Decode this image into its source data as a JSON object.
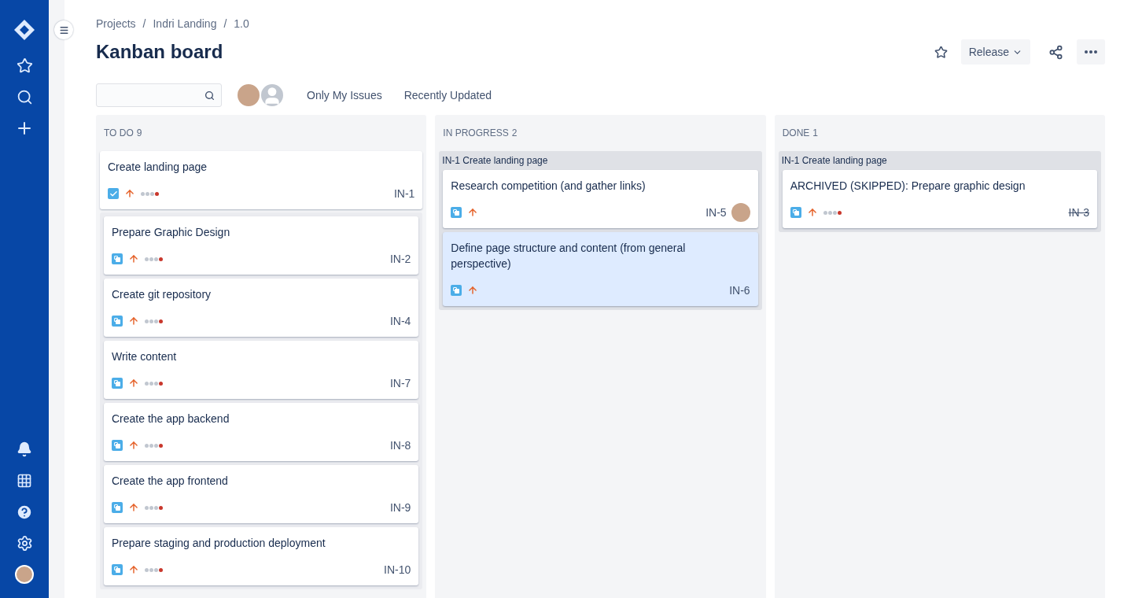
{
  "breadcrumbs": {
    "separator": "/",
    "items": [
      "Projects",
      "Indri Landing",
      "1.0"
    ]
  },
  "title": "Kanban board",
  "actions": {
    "release": "Release"
  },
  "filters": {
    "quick_filters": [
      "Only My Issues",
      "Recently Updated"
    ]
  },
  "columns": [
    {
      "title": "TO DO",
      "count": "9",
      "parent": {
        "title": "Create landing page",
        "kind": "task",
        "key": "IN-1",
        "done": false,
        "estimate": true,
        "assigned": false,
        "selected": false
      },
      "cards": [
        {
          "title": "Prepare Graphic Design",
          "kind": "subtask",
          "key": "IN-2",
          "done": false,
          "estimate": true,
          "assigned": false,
          "selected": false
        },
        {
          "title": "Create git repository",
          "kind": "subtask",
          "key": "IN-4",
          "done": false,
          "estimate": true,
          "assigned": false,
          "selected": false
        },
        {
          "title": "Write content",
          "kind": "subtask",
          "key": "IN-7",
          "done": false,
          "estimate": true,
          "assigned": false,
          "selected": false
        },
        {
          "title": "Create the app backend",
          "kind": "subtask",
          "key": "IN-8",
          "done": false,
          "estimate": true,
          "assigned": false,
          "selected": false
        },
        {
          "title": "Create the app frontend",
          "kind": "subtask",
          "key": "IN-9",
          "done": false,
          "estimate": true,
          "assigned": false,
          "selected": false
        },
        {
          "title": "Prepare staging and production deployment",
          "kind": "subtask",
          "key": "IN-10",
          "done": false,
          "estimate": true,
          "assigned": false,
          "selected": false
        }
      ]
    },
    {
      "title": "IN PROGRESS",
      "count": "2",
      "group_label": "IN-1 Create landing page",
      "cards": [
        {
          "title": "Research competition (and gather links)",
          "kind": "subtask",
          "key": "IN-5",
          "done": false,
          "estimate": false,
          "assigned": true,
          "selected": false
        },
        {
          "title": "Define page structure and content (from general perspective)",
          "kind": "subtask",
          "key": "IN-6",
          "done": false,
          "estimate": false,
          "assigned": false,
          "selected": true
        }
      ]
    },
    {
      "title": "DONE",
      "count": "1",
      "group_label": "IN-1 Create landing page",
      "cards": [
        {
          "title": "ARCHIVED (SKIPPED): Prepare graphic design",
          "kind": "subtask",
          "key": "IN-3",
          "done": true,
          "estimate": true,
          "assigned": false,
          "selected": false
        }
      ]
    }
  ]
}
